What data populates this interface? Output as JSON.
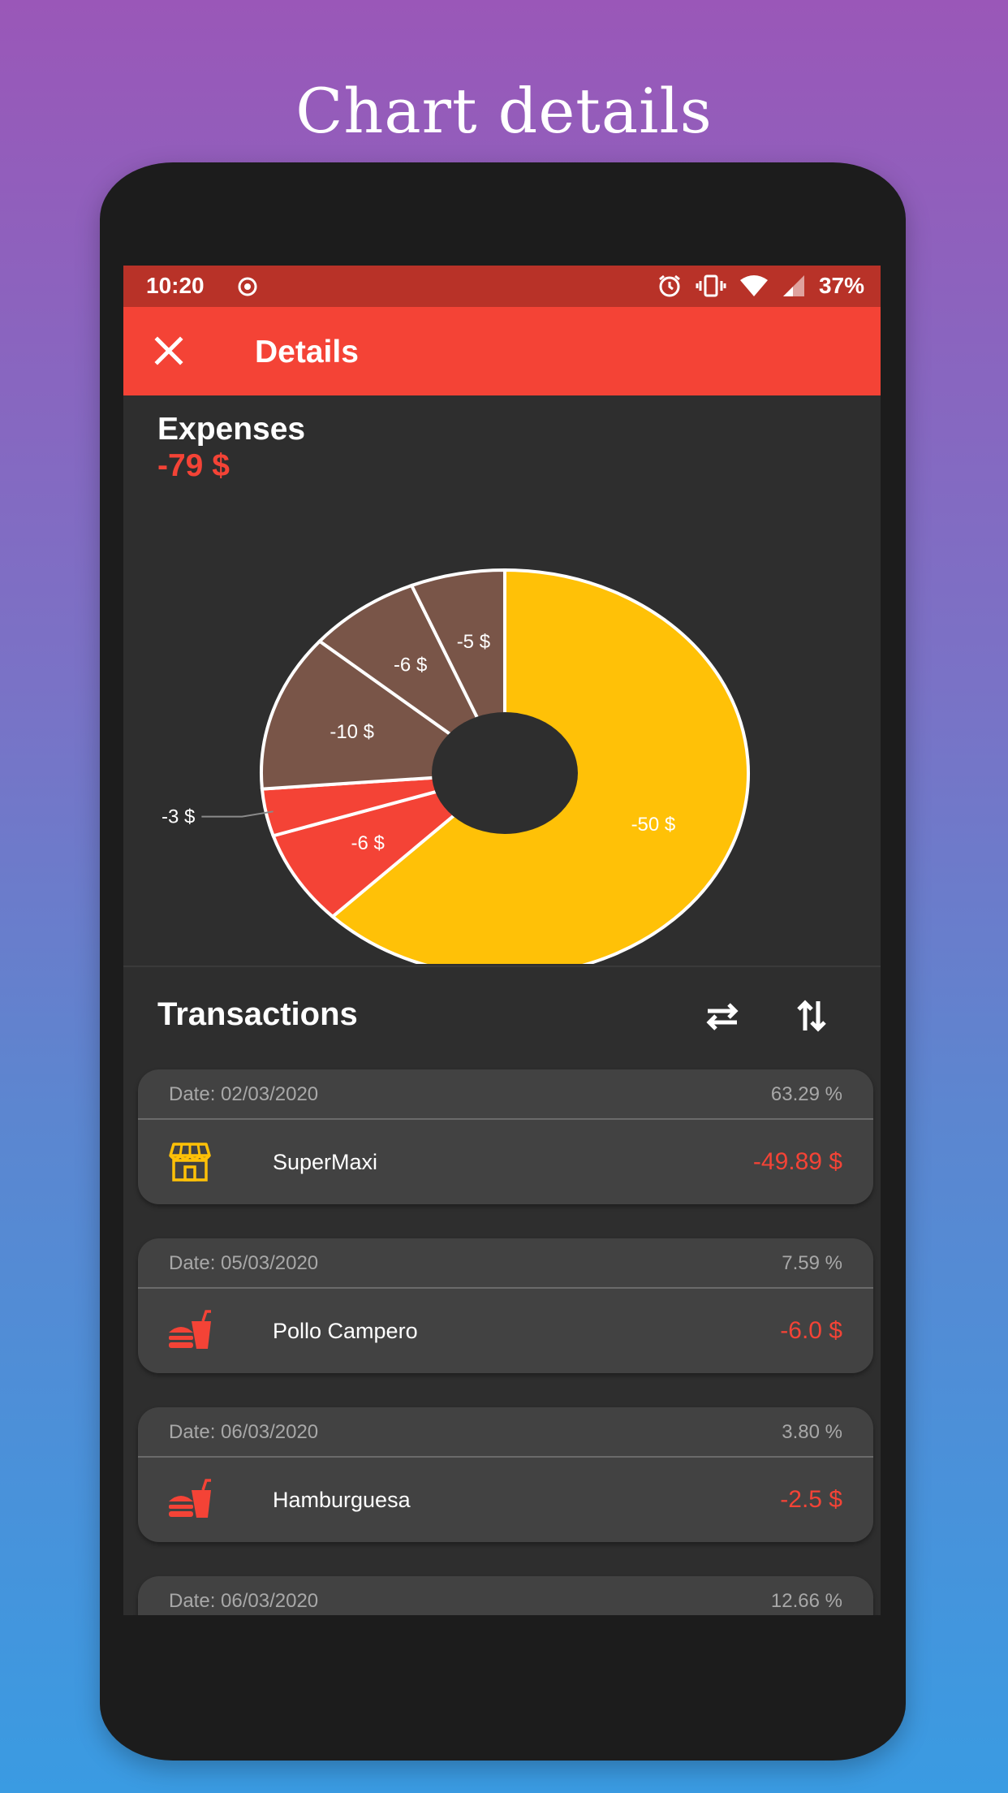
{
  "promo": {
    "title": "Chart details"
  },
  "status_bar": {
    "time": "10:20",
    "battery": "37%"
  },
  "app_bar": {
    "title": "Details",
    "close_icon": "close-icon"
  },
  "summary": {
    "label": "Expenses",
    "total": "-79 $",
    "total_color": "#f44336"
  },
  "chart_data": {
    "type": "pie",
    "hole": true,
    "slices": [
      {
        "label": "-50 $",
        "value": 50,
        "color": "#ffc107"
      },
      {
        "label": "-6 $",
        "value": 6,
        "color": "#f44336"
      },
      {
        "label": "-3 $",
        "value": 3,
        "color": "#f44336"
      },
      {
        "label": "-10 $",
        "value": 10,
        "color": "#795548"
      },
      {
        "label": "-6 $",
        "value": 6,
        "color": "#795548"
      },
      {
        "label": "-5 $",
        "value": 5,
        "color": "#795548"
      }
    ]
  },
  "transactions": {
    "title": "Transactions",
    "items": [
      {
        "date": "Date: 02/03/2020",
        "percent": "63.29 %",
        "name": "SuperMaxi",
        "amount": "-49.89 $",
        "icon": "store-icon",
        "icon_color": "#ffc107"
      },
      {
        "date": "Date: 05/03/2020",
        "percent": "7.59 %",
        "name": "Pollo Campero",
        "amount": "-6.0 $",
        "icon": "fastfood-icon",
        "icon_color": "#f44336"
      },
      {
        "date": "Date: 06/03/2020",
        "percent": "3.80 %",
        "name": "Hamburguesa",
        "amount": "-2.5 $",
        "icon": "fastfood-icon",
        "icon_color": "#f44336"
      },
      {
        "date": "Date: 06/03/2020",
        "percent": "12.66 %"
      }
    ]
  }
}
